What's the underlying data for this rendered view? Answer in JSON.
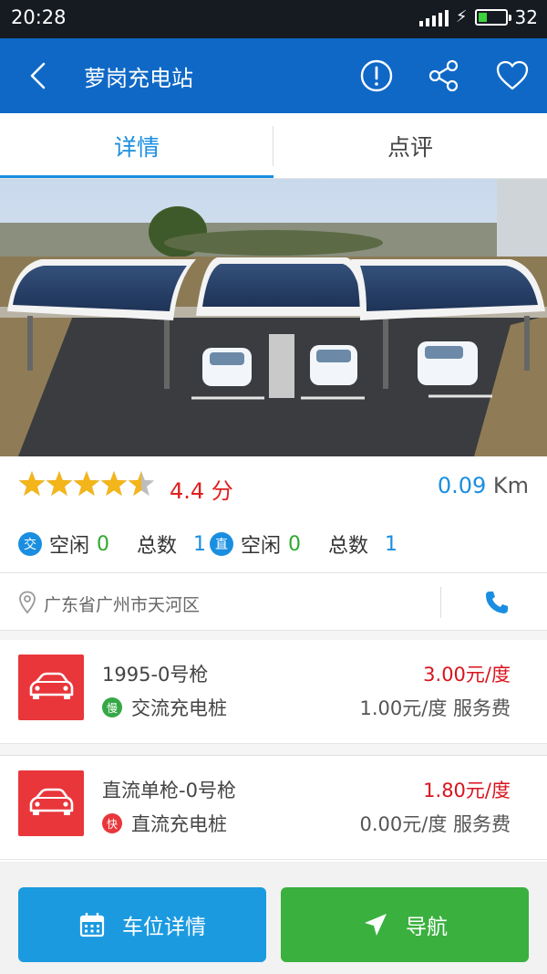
{
  "status_bar": {
    "time": "20:28",
    "battery": "32",
    "battery_level": 0.32
  },
  "header": {
    "title": "萝岗充电站"
  },
  "tabs": [
    {
      "label": "详情",
      "active": true
    },
    {
      "label": "点评",
      "active": false
    }
  ],
  "banner": {
    "slide_count": 3,
    "active_slide": 2
  },
  "rating": {
    "stars": 4.5,
    "score": "4.4 分",
    "distance_value": "0.09",
    "distance_unit": " Km"
  },
  "counts": {
    "ac": {
      "badge": "交",
      "idle_label": "空闲",
      "idle": "0",
      "total_label": "总数",
      "total": "1"
    },
    "dc": {
      "badge": "直",
      "idle_label": "空闲",
      "idle": "0",
      "total_label": "总数",
      "total": "1"
    }
  },
  "address": "广东省广州市天河区",
  "chargers": [
    {
      "name": "1995-0号枪",
      "badge": "慢",
      "type": "交流充电桩",
      "price": "3.00元/度",
      "service_fee": "1.00元/度 服务费"
    },
    {
      "name": "直流单枪-0号枪",
      "badge": "快",
      "type": "直流充电桩",
      "price": "1.80元/度",
      "service_fee": "0.00元/度 服务费"
    }
  ],
  "actions": {
    "parking_details": "车位详情",
    "navigate": "导航"
  },
  "colors": {
    "primary": "#0f68c6",
    "accent_blue": "#1a8ee0",
    "price_red": "#d8141e",
    "nav_green": "#3ab03f",
    "parking_blue": "#1b9ae0",
    "star_gold": "#f3b519"
  },
  "icons": [
    "back-icon",
    "info-icon",
    "share-icon",
    "heart-icon",
    "star-icon",
    "location-pin-icon",
    "phone-icon",
    "car-icon",
    "calendar-icon",
    "navigation-arrow-icon"
  ]
}
